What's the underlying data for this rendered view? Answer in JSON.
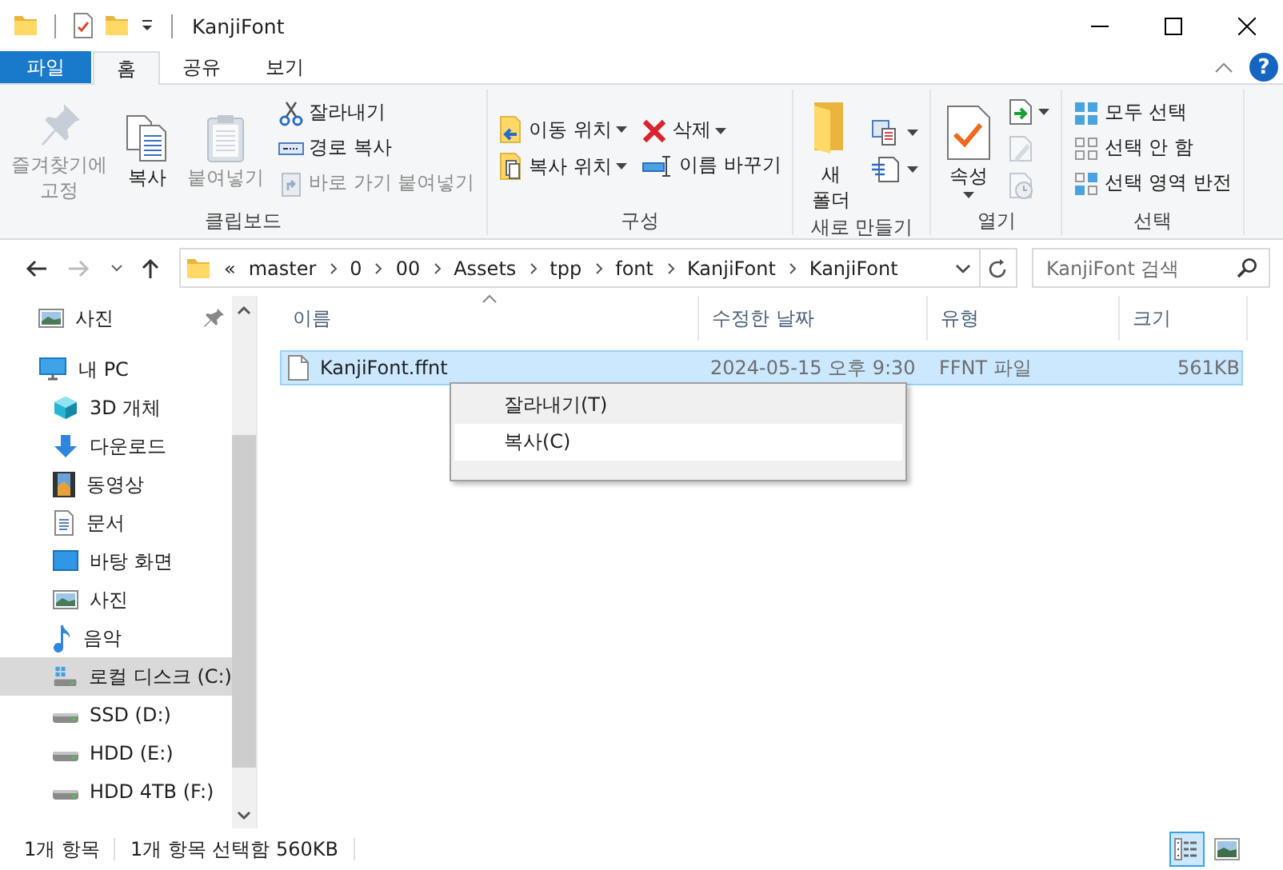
{
  "window": {
    "title": "KanjiFont",
    "help": "?"
  },
  "ribbon_tabs": [
    {
      "label": "파일",
      "kind": "file",
      "selected": false
    },
    {
      "label": "홈",
      "kind": "tab",
      "selected": true
    },
    {
      "label": "공유",
      "kind": "tab",
      "selected": false
    },
    {
      "label": "보기",
      "kind": "tab",
      "selected": false
    }
  ],
  "ribbon_groups": [
    {
      "label": "클립보드",
      "columns": [
        [
          {
            "kind": "large",
            "label": "즐겨찾기에\n고정",
            "disabled": true,
            "dropdown": false
          }
        ],
        [
          {
            "kind": "large",
            "label": "복사",
            "disabled": false,
            "dropdown": false
          }
        ],
        [
          {
            "kind": "large",
            "label": "붙여넣기",
            "disabled": true,
            "dropdown": false
          }
        ],
        [
          {
            "kind": "small",
            "label": "잘라내기",
            "disabled": false,
            "dropdown": false
          },
          {
            "kind": "small",
            "label": "경로 복사",
            "disabled": false,
            "dropdown": false
          },
          {
            "kind": "small",
            "label": "바로 가기 붙여넣기",
            "disabled": true,
            "dropdown": false
          }
        ]
      ]
    },
    {
      "label": "구성",
      "columns": [
        [
          {
            "kind": "small",
            "label": "이동 위치",
            "disabled": false,
            "dropdown": true
          },
          {
            "kind": "small",
            "label": "복사 위치",
            "disabled": false,
            "dropdown": true
          }
        ],
        [
          {
            "kind": "small",
            "label": "삭제",
            "disabled": false,
            "dropdown": true
          },
          {
            "kind": "small",
            "label": "이름 바꾸기",
            "disabled": false,
            "dropdown": false
          }
        ]
      ]
    },
    {
      "label": "새로 만들기",
      "columns": [
        [
          {
            "kind": "large",
            "label": "새\n폴더",
            "disabled": false,
            "dropdown": false
          }
        ],
        [
          {
            "kind": "icon",
            "disabled": false,
            "dropdown": true
          },
          {
            "kind": "icon",
            "disabled": false,
            "dropdown": true
          }
        ]
      ]
    },
    {
      "label": "열기",
      "columns": [
        [
          {
            "kind": "large",
            "label": "속성",
            "disabled": false,
            "dropdown": true
          }
        ],
        [
          {
            "kind": "icon",
            "disabled": false,
            "dropdown": true
          },
          {
            "kind": "icon",
            "disabled": true,
            "dropdown": false
          },
          {
            "kind": "icon",
            "disabled": true,
            "dropdown": false
          }
        ]
      ]
    },
    {
      "label": "선택",
      "columns": [
        [
          {
            "kind": "small",
            "label": "모두 선택",
            "disabled": false,
            "dropdown": false
          },
          {
            "kind": "small",
            "label": "선택 안 함",
            "disabled": false,
            "dropdown": false
          },
          {
            "kind": "small",
            "label": "선택 영역 반전",
            "disabled": false,
            "dropdown": false
          }
        ]
      ]
    }
  ],
  "address": {
    "overflow": "«",
    "crumbs": [
      "master",
      "0",
      "00",
      "Assets",
      "tpp",
      "font",
      "KanjiFont",
      "KanjiFont"
    ]
  },
  "search": {
    "placeholder": "KanjiFont 검색"
  },
  "nav": [
    {
      "label": "사진",
      "pinned": true,
      "selected": false
    },
    {
      "label": "내 PC",
      "pinned": false,
      "selected": false,
      "children": [
        {
          "label": "3D 개체",
          "selected": false
        },
        {
          "label": "다운로드",
          "selected": false
        },
        {
          "label": "동영상",
          "selected": false
        },
        {
          "label": "문서",
          "selected": false
        },
        {
          "label": "바탕 화면",
          "selected": false
        },
        {
          "label": "사진",
          "selected": false
        },
        {
          "label": "음악",
          "selected": false
        },
        {
          "label": "로컬 디스크 (C:)",
          "selected": true
        },
        {
          "label": "SSD (D:)",
          "selected": false
        },
        {
          "label": "HDD (E:)",
          "selected": false
        },
        {
          "label": "HDD 4TB (F:)",
          "selected": false
        }
      ]
    }
  ],
  "columns": [
    {
      "label": "이름",
      "sorted": true
    },
    {
      "label": "수정한 날짜",
      "sorted": false
    },
    {
      "label": "유형",
      "sorted": false
    },
    {
      "label": "크기",
      "sorted": false
    }
  ],
  "files": [
    {
      "name": "KanjiFont.ffnt",
      "modified": "2024-05-15 오후 9:30",
      "type": "FFNT 파일",
      "size": "561KB",
      "selected": true
    }
  ],
  "context_menu": [
    {
      "label": "잘라내기(T)",
      "highlighted": false
    },
    {
      "label": "복사(C)",
      "highlighted": true
    }
  ],
  "status_bar": {
    "count": "1개 항목",
    "selection": "1개 항목 선택함 560KB"
  },
  "view_buttons": [
    {
      "kind": "details",
      "selected": true
    },
    {
      "kind": "large_icons",
      "selected": false
    }
  ]
}
